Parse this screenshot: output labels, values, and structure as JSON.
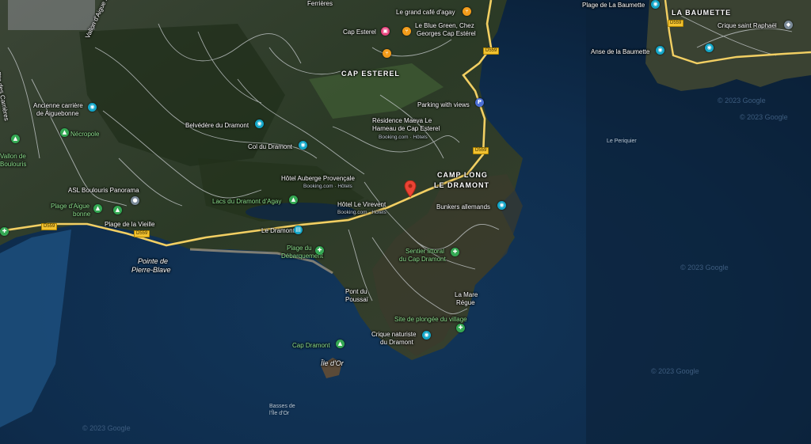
{
  "map": {
    "roads": {
      "d559": "D559"
    },
    "places": {
      "la_baumette": "LA BAUMETTE",
      "plage_baumette": "Plage de La Baumette",
      "crique_saint_raphael": "Crique saint Raphaël",
      "anse_baumette": "Anse de la Baumette",
      "le_periquier": "Le Periquier",
      "cap_esterel": "CAP ESTEREL",
      "cap_esterel_poi": "Cap Esterel",
      "grand_cafe": "Le grand café d'agay",
      "blue_green": "Le Blue Green, Chez",
      "blue_green_2": "Georges Cap Estérel",
      "parking": "Parking with views",
      "residence": "Résidence Maeva Le",
      "residence_2": "Hameau de Cap Esterel",
      "residence_sub": "Booking.com · Hôtels",
      "camp_long": "CAMP LONG",
      "le_dramont_area": "LE DRAMONT",
      "belvedere": "Belvédère du Dramont",
      "col_dramont": "Col du Dramont",
      "auberge": "Hôtel Auberge Provençale",
      "auberge_sub": "Booking.com · Hôtels",
      "virevent": "Hôtel Le Virevent",
      "virevent_sub": "Booking.com · Hôtels",
      "bunkers": "Bunkers allemands",
      "lacs": "Lacs du Dramont d'Agay",
      "le_dramont_station": "Le Dramont",
      "plage_debarquement": "Plage du",
      "plage_debarquement_2": "Débarquement",
      "sentier": "Sentier littoral",
      "sentier_2": "du Cap Dramont",
      "pont_poussai": "Pont du",
      "pont_poussai_2": "Poussaï",
      "la_mare": "La Mare",
      "la_mare_2": "Régue",
      "site_plongee": "Site de plongée du village",
      "crique_naturiste": "Crique naturiste",
      "crique_naturiste_2": "du Dramont",
      "cap_dramont": "Cap Dramont",
      "ile_dor": "Île d'Or",
      "basses": "Basses de",
      "basses_2": "l'Île d'Or",
      "pointe": "Pointe de",
      "pointe_2": "Pierre-Blave",
      "anc_carriere": "Ancienne carrière",
      "anc_carriere_2": "de Aiguebonne",
      "necropole": "Nécropole",
      "asl": "ASL Boulouris Panorama",
      "plage_aiguebonne": "Plage d'Aigue",
      "plage_aiguebonne_2": "bonne",
      "plage_vieille": "Plage de la Vieille",
      "vallon_aigue": "Vallon d'Aigue Bonne",
      "rue_carrieres": "Rte des Carrières",
      "vallon_boulouris": "Vallon de",
      "vallon_boulouris_2": "Boulouris",
      "ferrieres": "Ferrières"
    },
    "copyright": {
      "c1": "© 2023 Google",
      "c2": "© 2023 Google",
      "c3": "© 2023 Google",
      "c4": "© 2023 Google",
      "c5": "© 2023 Google"
    }
  }
}
